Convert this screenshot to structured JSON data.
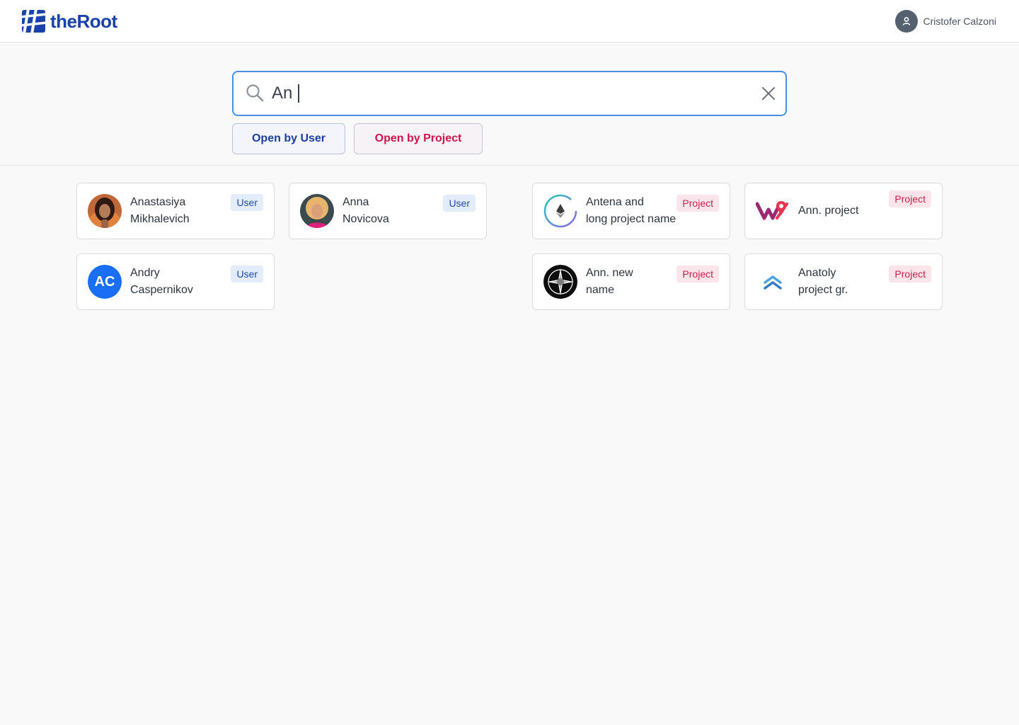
{
  "header": {
    "brand": "theRoot",
    "user_name": "Cristofer Calzoni"
  },
  "search": {
    "value": "An",
    "placeholder": ""
  },
  "filters": {
    "open_by_user": "Open by User",
    "open_by_project": "Open by Project"
  },
  "users": [
    {
      "name_line1": "Anastasiya",
      "name_line2": "Mikhalevich",
      "badge": "User"
    },
    {
      "name_line1": "Anna",
      "name_line2": "Novicova",
      "badge": "User"
    },
    {
      "name_line1": "Andry",
      "name_line2": "Caspernikov",
      "badge": "User",
      "initials": "AC"
    }
  ],
  "projects": [
    {
      "name_line1": "Antena and",
      "name_line2": "long project name",
      "badge": "Project"
    },
    {
      "name": "Ann. project",
      "badge": "Project"
    },
    {
      "name_line1": "Ann. new",
      "name_line2": "name",
      "badge": "Project"
    },
    {
      "name_line1": "Anatoly",
      "name_line2": "project gr.",
      "badge": "Project"
    }
  ],
  "colors": {
    "brand": "#1943a8",
    "search_focus": "#4a90e2",
    "user_badge_bg": "#e3ecfb",
    "user_badge_text": "#1e4aa8",
    "project_badge_bg": "#fbe4ea",
    "project_badge_text": "#c7204f",
    "initials_avatar": "#1a6ef5"
  },
  "icons": {
    "logo": "brand-mark-icon",
    "search": "search-icon",
    "clear": "close-icon",
    "account": "user-icon"
  }
}
